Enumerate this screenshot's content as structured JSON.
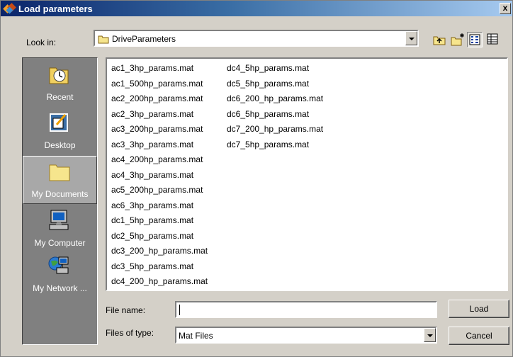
{
  "window": {
    "title": "Load parameters",
    "close_label": "x"
  },
  "lookin": {
    "label": "Look in:",
    "folder": "DriveParameters"
  },
  "places": [
    {
      "label": "Recent",
      "icon": "recent-icon",
      "selected": false
    },
    {
      "label": "Desktop",
      "icon": "desktop-icon",
      "selected": false
    },
    {
      "label": "My Documents",
      "icon": "my-documents-folder-icon",
      "selected": true
    },
    {
      "label": "My Computer",
      "icon": "my-computer-icon",
      "selected": false
    },
    {
      "label": "My Network ...",
      "icon": "my-network-icon",
      "selected": false
    }
  ],
  "files": {
    "column1": [
      "ac1_3hp_params.mat",
      "ac1_500hp_params.mat",
      "ac2_200hp_params.mat",
      "ac2_3hp_params.mat",
      "ac3_200hp_params.mat",
      "ac3_3hp_params.mat",
      "ac4_200hp_params.mat",
      "ac4_3hp_params.mat",
      "ac5_200hp_params.mat",
      "ac6_3hp_params.mat",
      "dc1_5hp_params.mat",
      "dc2_5hp_params.mat",
      "dc3_200_hp_params.mat",
      "dc3_5hp_params.mat",
      "dc4_200_hp_params.mat"
    ],
    "column2": [
      "dc4_5hp_params.mat",
      "dc5_5hp_params.mat",
      "dc6_200_hp_params.mat",
      "dc6_5hp_params.mat",
      "dc7_200_hp_params.mat",
      "dc7_5hp_params.mat"
    ]
  },
  "filename": {
    "label": "File name:",
    "value": ""
  },
  "filetype": {
    "label": "Files of type:",
    "value": "Mat Files"
  },
  "buttons": {
    "load": "Load",
    "cancel": "Cancel"
  }
}
